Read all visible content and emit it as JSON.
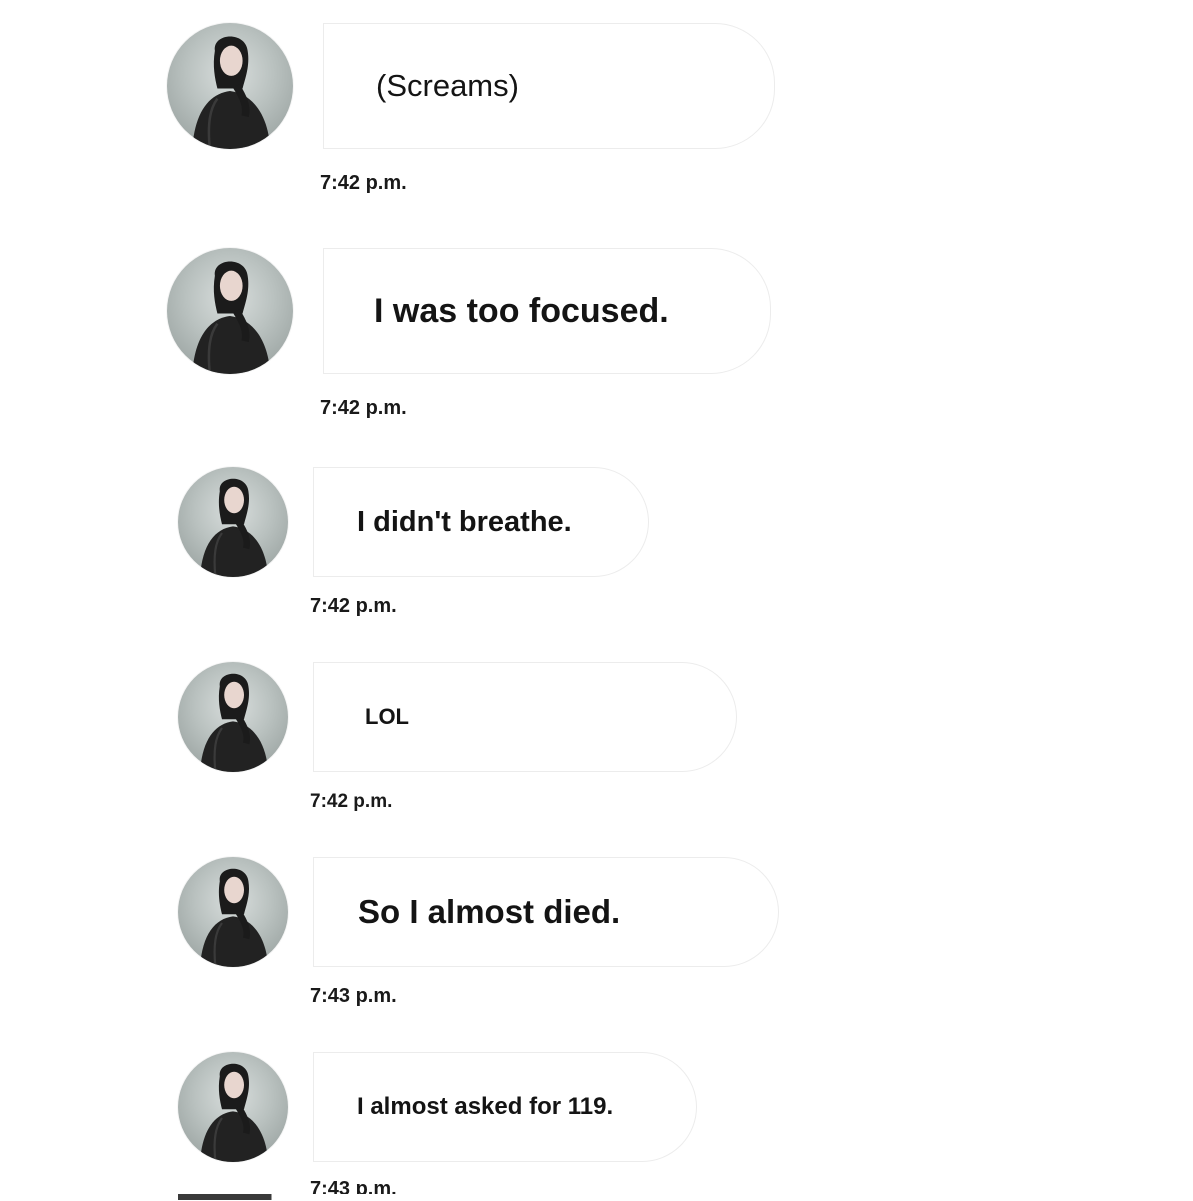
{
  "messages": [
    {
      "text": "(Screams)",
      "time": "7:42 p.m."
    },
    {
      "text": "I was too focused.",
      "time": "7:42 p.m."
    },
    {
      "text": "I didn't breathe.",
      "time": "7:42 p.m."
    },
    {
      "text": "LOL",
      "time": "7:42 p.m."
    },
    {
      "text": "So I almost died.",
      "time": "7:43 p.m."
    },
    {
      "text": "I almost asked for 119.",
      "time": "7:43 p.m."
    }
  ],
  "avatar": {
    "icon": "profile-photo-icon"
  }
}
